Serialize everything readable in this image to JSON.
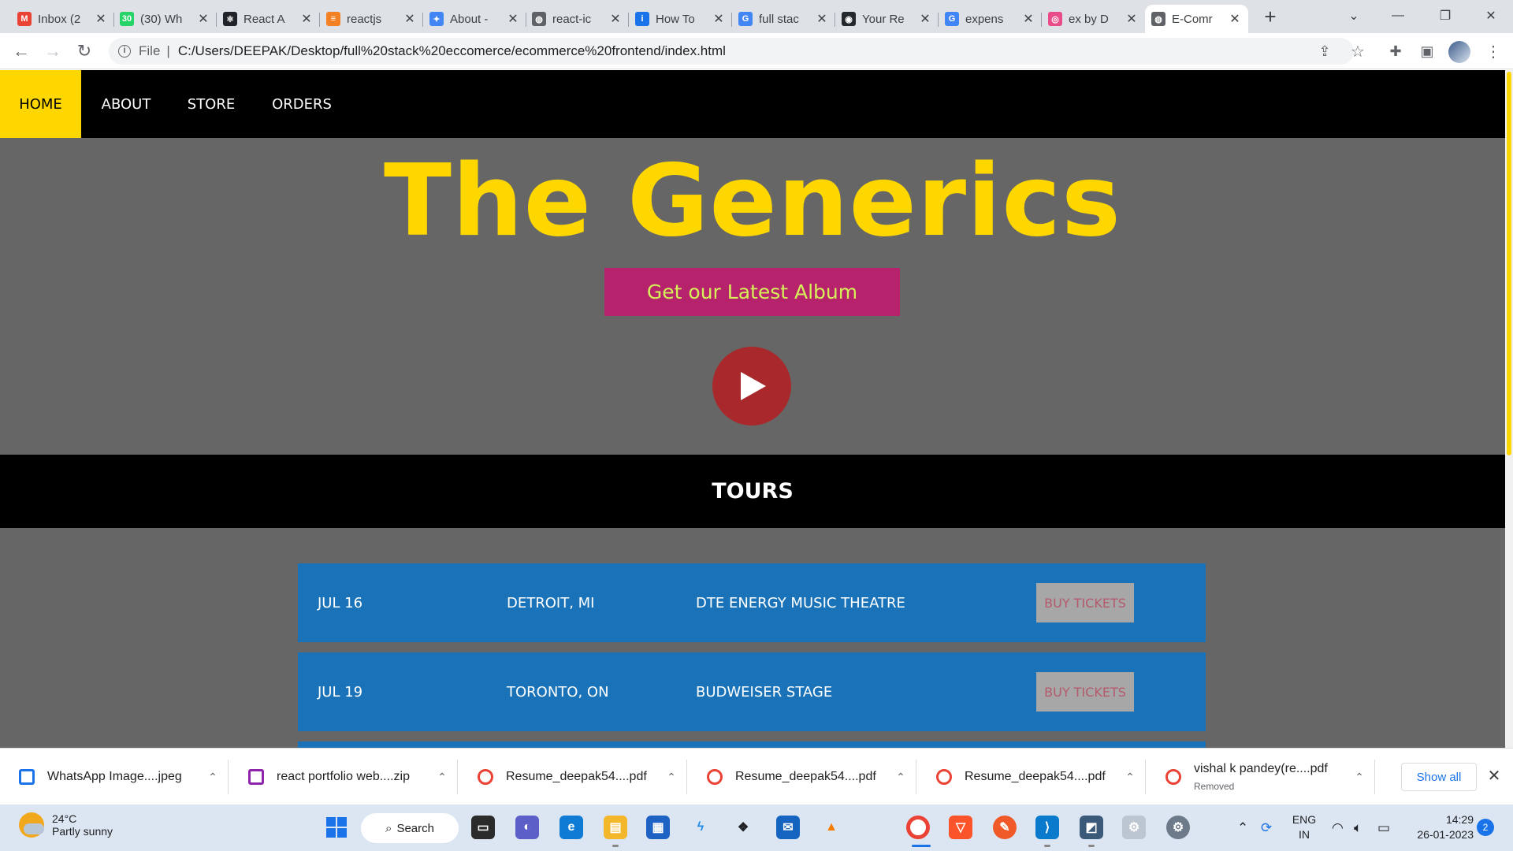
{
  "browser": {
    "tabs": [
      {
        "title": "Inbox (2",
        "favicon": "gmail-icon",
        "color": "#ea4335",
        "glyph": "M"
      },
      {
        "title": "(30) Wh",
        "favicon": "whatsapp-icon",
        "color": "#25d366",
        "glyph": "30"
      },
      {
        "title": "React A",
        "favicon": "react-icon",
        "color": "#20232a",
        "glyph": "⚛"
      },
      {
        "title": "reactjs",
        "favicon": "stackoverflow-icon",
        "color": "#f48024",
        "glyph": "≡"
      },
      {
        "title": "About -",
        "favicon": "about-icon",
        "color": "#4285f4",
        "glyph": "✦"
      },
      {
        "title": "react-ic",
        "favicon": "globe-icon",
        "color": "#5f6368",
        "glyph": "◍"
      },
      {
        "title": "How To",
        "favicon": "info-page-icon",
        "color": "#1a73e8",
        "glyph": "i"
      },
      {
        "title": "full stac",
        "favicon": "google-icon",
        "color": "#4285f4",
        "glyph": "G"
      },
      {
        "title": "Your Re",
        "favicon": "github-icon",
        "color": "#24292e",
        "glyph": "◉"
      },
      {
        "title": "expens",
        "favicon": "google-icon",
        "color": "#4285f4",
        "glyph": "G"
      },
      {
        "title": "ex by D",
        "favicon": "dribbble-icon",
        "color": "#ea4c89",
        "glyph": "◎"
      },
      {
        "title": "E-Comr",
        "favicon": "globe-icon",
        "color": "#5f6368",
        "glyph": "◍"
      }
    ],
    "new_tab_glyph": "+",
    "address": {
      "scheme": "File",
      "divider": "|",
      "url": "C:/Users/DEEPAK/Desktop/full%20stack%20eccomerce/ecommerce%20frontend/index.html"
    }
  },
  "site": {
    "nav": [
      "HOME",
      "ABOUT",
      "STORE",
      "ORDERS"
    ],
    "hero_title": "The Generics",
    "album_button": "Get our Latest Album",
    "tours_heading": "TOURS",
    "tours": [
      {
        "date": "JUL 16",
        "city": "DETROIT, MI",
        "venue": "DTE ENERGY MUSIC THEATRE",
        "button": "BUY TICKETS"
      },
      {
        "date": "JUL 19",
        "city": "TORONTO, ON",
        "venue": "BUDWEISER STAGE",
        "button": "BUY TICKETS"
      }
    ]
  },
  "downloads": {
    "items": [
      {
        "name": "WhatsApp Image....jpeg",
        "sub": "",
        "icon": "image-file-icon"
      },
      {
        "name": "react portfolio web....zip",
        "sub": "",
        "icon": "zip-file-icon"
      },
      {
        "name": "Resume_deepak54....pdf",
        "sub": "",
        "icon": "chrome-pdf-icon"
      },
      {
        "name": "Resume_deepak54....pdf",
        "sub": "",
        "icon": "chrome-pdf-icon"
      },
      {
        "name": "Resume_deepak54....pdf",
        "sub": "",
        "icon": "chrome-pdf-icon"
      },
      {
        "name": "vishal k pandey(re....pdf",
        "sub": "Removed",
        "icon": "chrome-pdf-icon"
      }
    ],
    "show_all": "Show all"
  },
  "taskbar": {
    "weather_temp": "24°C",
    "weather_desc": "Partly sunny",
    "search_label": "Search",
    "lang_line1": "ENG",
    "lang_line2": "IN",
    "time": "14:29",
    "date": "26-01-2023",
    "notifications": "2"
  }
}
